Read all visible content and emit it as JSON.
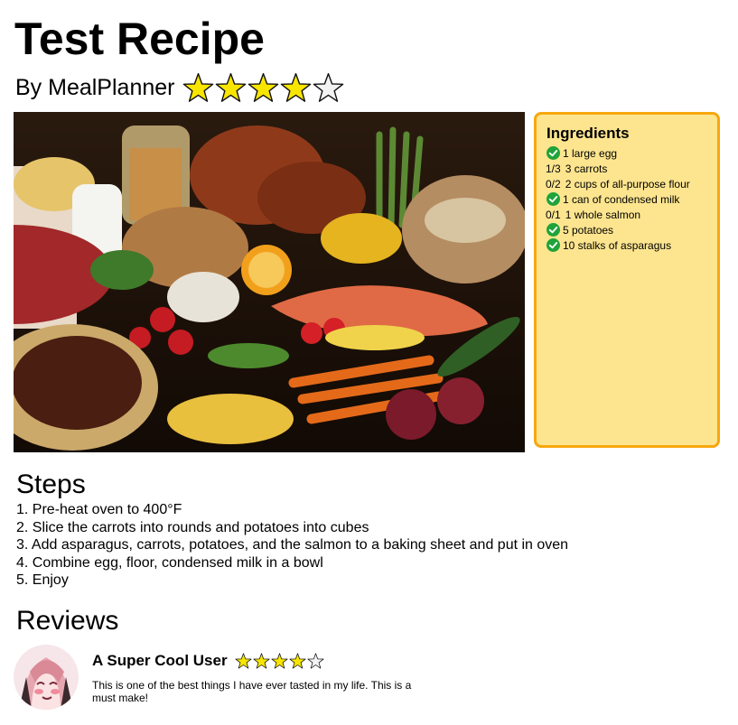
{
  "recipe": {
    "title": "Test Recipe",
    "author": "By MealPlanner",
    "rating": 4,
    "rating_max": 5
  },
  "ingredients": {
    "heading": "Ingredients",
    "items": [
      {
        "status": "check",
        "text": "1 large egg"
      },
      {
        "status": "1/3",
        "text": "3 carrots"
      },
      {
        "status": "0/2",
        "text": "2 cups of all-purpose flour"
      },
      {
        "status": "check",
        "text": "1 can of condensed milk"
      },
      {
        "status": "0/1",
        "text": "1 whole salmon"
      },
      {
        "status": "check",
        "text": "5 potatoes"
      },
      {
        "status": "check",
        "text": "10 stalks of asparagus"
      }
    ]
  },
  "steps": {
    "heading": "Steps",
    "items": [
      "1. Pre-heat oven to 400°F",
      "2. Slice the carrots into rounds and potatoes into cubes",
      "3. Add asparagus, carrots, potatoes, and the salmon to a baking sheet and put in oven",
      "4. Combine egg, floor, condensed milk in a bowl",
      "5. Enjoy"
    ]
  },
  "reviews": {
    "heading": "Reviews",
    "items": [
      {
        "user": "A Super Cool User",
        "rating": 4,
        "rating_max": 5,
        "text": "This is one of the best things I have ever tasted in my life. This is a must make!"
      }
    ]
  },
  "icons": {
    "star": "star-icon",
    "check": "check-circle-icon",
    "avatar": "avatar-image"
  },
  "colors": {
    "star_fill": "#f9e600",
    "star_empty": "#f2f2f2",
    "ingredients_bg": "#fde58f",
    "ingredients_border": "#f7a70f",
    "check_green": "#1fa33a"
  }
}
